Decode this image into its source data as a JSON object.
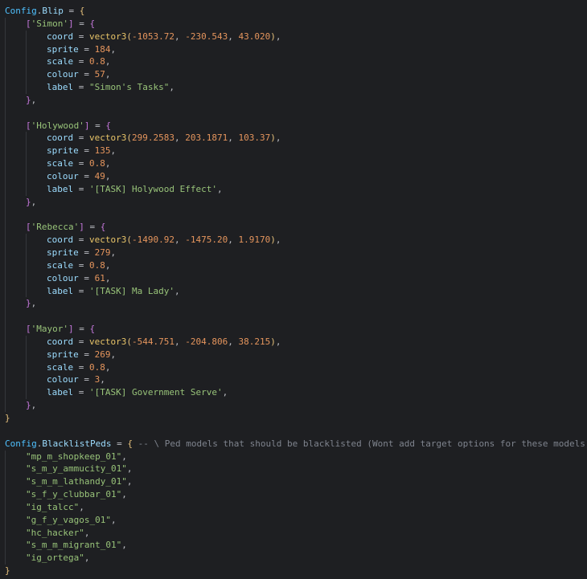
{
  "editor": {
    "language": "lua",
    "colors": {
      "background": "#1e1f22",
      "text": "#bcbec4",
      "object": "#4fc1ff",
      "property": "#9cdcfe",
      "string": "#98c379",
      "number": "#e5955d",
      "function": "#e8c468",
      "brace": "#e5c07b",
      "brace_nested": "#c678dd",
      "comment": "#7f848e"
    },
    "lines": [
      {
        "indent": 0,
        "tokens": [
          [
            "obj",
            "Config"
          ],
          [
            "op",
            "."
          ],
          [
            "prop",
            "Blip"
          ],
          [
            "op",
            " = "
          ],
          [
            "brace",
            "{"
          ]
        ]
      },
      {
        "indent": 1,
        "tokens": [
          [
            "brace2",
            "["
          ],
          [
            "str",
            "'Simon'"
          ],
          [
            "brace2",
            "]"
          ],
          [
            "op",
            " = "
          ],
          [
            "brace2",
            "{"
          ]
        ]
      },
      {
        "indent": 2,
        "tokens": [
          [
            "prop",
            "coord"
          ],
          [
            "op",
            " = "
          ],
          [
            "fn",
            "vector3"
          ],
          [
            "brace",
            "("
          ],
          [
            "num",
            "-1053.72"
          ],
          [
            "punc",
            ", "
          ],
          [
            "num",
            "-230.543"
          ],
          [
            "punc",
            ", "
          ],
          [
            "num",
            "43.020"
          ],
          [
            "brace",
            ")"
          ],
          [
            "punc",
            ","
          ]
        ]
      },
      {
        "indent": 2,
        "tokens": [
          [
            "prop",
            "sprite"
          ],
          [
            "op",
            " = "
          ],
          [
            "num",
            "184"
          ],
          [
            "punc",
            ","
          ]
        ]
      },
      {
        "indent": 2,
        "tokens": [
          [
            "prop",
            "scale"
          ],
          [
            "op",
            " = "
          ],
          [
            "num",
            "0.8"
          ],
          [
            "punc",
            ","
          ]
        ]
      },
      {
        "indent": 2,
        "tokens": [
          [
            "prop",
            "colour"
          ],
          [
            "op",
            " = "
          ],
          [
            "num",
            "57"
          ],
          [
            "punc",
            ","
          ]
        ]
      },
      {
        "indent": 2,
        "tokens": [
          [
            "prop",
            "label"
          ],
          [
            "op",
            " = "
          ],
          [
            "str",
            "\"Simon's Tasks\""
          ],
          [
            "punc",
            ","
          ]
        ]
      },
      {
        "indent": 1,
        "tokens": [
          [
            "brace2",
            "}"
          ],
          [
            "punc",
            ","
          ]
        ]
      },
      {
        "indent": 1,
        "tokens": []
      },
      {
        "indent": 1,
        "tokens": [
          [
            "brace2",
            "["
          ],
          [
            "str",
            "'Holywood'"
          ],
          [
            "brace2",
            "]"
          ],
          [
            "op",
            " = "
          ],
          [
            "brace2",
            "{"
          ]
        ]
      },
      {
        "indent": 2,
        "tokens": [
          [
            "prop",
            "coord"
          ],
          [
            "op",
            " = "
          ],
          [
            "fn",
            "vector3"
          ],
          [
            "brace",
            "("
          ],
          [
            "num",
            "299.2583"
          ],
          [
            "punc",
            ", "
          ],
          [
            "num",
            "203.1871"
          ],
          [
            "punc",
            ", "
          ],
          [
            "num",
            "103.37"
          ],
          [
            "brace",
            ")"
          ],
          [
            "punc",
            ","
          ]
        ]
      },
      {
        "indent": 2,
        "tokens": [
          [
            "prop",
            "sprite"
          ],
          [
            "op",
            " = "
          ],
          [
            "num",
            "135"
          ],
          [
            "punc",
            ","
          ]
        ]
      },
      {
        "indent": 2,
        "tokens": [
          [
            "prop",
            "scale"
          ],
          [
            "op",
            " = "
          ],
          [
            "num",
            "0.8"
          ],
          [
            "punc",
            ","
          ]
        ]
      },
      {
        "indent": 2,
        "tokens": [
          [
            "prop",
            "colour"
          ],
          [
            "op",
            " = "
          ],
          [
            "num",
            "49"
          ],
          [
            "punc",
            ","
          ]
        ]
      },
      {
        "indent": 2,
        "tokens": [
          [
            "prop",
            "label"
          ],
          [
            "op",
            " = "
          ],
          [
            "str",
            "'[TASK] Holywood Effect'"
          ],
          [
            "punc",
            ","
          ]
        ]
      },
      {
        "indent": 1,
        "tokens": [
          [
            "brace2",
            "}"
          ],
          [
            "punc",
            ","
          ]
        ]
      },
      {
        "indent": 1,
        "tokens": []
      },
      {
        "indent": 1,
        "tokens": [
          [
            "brace2",
            "["
          ],
          [
            "str",
            "'Rebecca'"
          ],
          [
            "brace2",
            "]"
          ],
          [
            "op",
            " = "
          ],
          [
            "brace2",
            "{"
          ]
        ]
      },
      {
        "indent": 2,
        "tokens": [
          [
            "prop",
            "coord"
          ],
          [
            "op",
            " = "
          ],
          [
            "fn",
            "vector3"
          ],
          [
            "brace",
            "("
          ],
          [
            "num",
            "-1490.92"
          ],
          [
            "punc",
            ", "
          ],
          [
            "num",
            "-1475.20"
          ],
          [
            "punc",
            ", "
          ],
          [
            "num",
            "1.9170"
          ],
          [
            "brace",
            ")"
          ],
          [
            "punc",
            ","
          ]
        ]
      },
      {
        "indent": 2,
        "tokens": [
          [
            "prop",
            "sprite"
          ],
          [
            "op",
            " = "
          ],
          [
            "num",
            "279"
          ],
          [
            "punc",
            ","
          ]
        ]
      },
      {
        "indent": 2,
        "tokens": [
          [
            "prop",
            "scale"
          ],
          [
            "op",
            " = "
          ],
          [
            "num",
            "0.8"
          ],
          [
            "punc",
            ","
          ]
        ]
      },
      {
        "indent": 2,
        "tokens": [
          [
            "prop",
            "colour"
          ],
          [
            "op",
            " = "
          ],
          [
            "num",
            "61"
          ],
          [
            "punc",
            ","
          ]
        ]
      },
      {
        "indent": 2,
        "tokens": [
          [
            "prop",
            "label"
          ],
          [
            "op",
            " = "
          ],
          [
            "str",
            "'[TASK] Ma Lady'"
          ],
          [
            "punc",
            ","
          ]
        ]
      },
      {
        "indent": 1,
        "tokens": [
          [
            "brace2",
            "}"
          ],
          [
            "punc",
            ","
          ]
        ]
      },
      {
        "indent": 1,
        "tokens": []
      },
      {
        "indent": 1,
        "tokens": [
          [
            "brace2",
            "["
          ],
          [
            "str",
            "'Mayor'"
          ],
          [
            "brace2",
            "]"
          ],
          [
            "op",
            " = "
          ],
          [
            "brace2",
            "{"
          ]
        ]
      },
      {
        "indent": 2,
        "tokens": [
          [
            "prop",
            "coord"
          ],
          [
            "op",
            " = "
          ],
          [
            "fn",
            "vector3"
          ],
          [
            "brace",
            "("
          ],
          [
            "num",
            "-544.751"
          ],
          [
            "punc",
            ", "
          ],
          [
            "num",
            "-204.806"
          ],
          [
            "punc",
            ", "
          ],
          [
            "num",
            "38.215"
          ],
          [
            "brace",
            ")"
          ],
          [
            "punc",
            ","
          ]
        ]
      },
      {
        "indent": 2,
        "tokens": [
          [
            "prop",
            "sprite"
          ],
          [
            "op",
            " = "
          ],
          [
            "num",
            "269"
          ],
          [
            "punc",
            ","
          ]
        ]
      },
      {
        "indent": 2,
        "tokens": [
          [
            "prop",
            "scale"
          ],
          [
            "op",
            " = "
          ],
          [
            "num",
            "0.8"
          ],
          [
            "punc",
            ","
          ]
        ]
      },
      {
        "indent": 2,
        "tokens": [
          [
            "prop",
            "colour"
          ],
          [
            "op",
            " = "
          ],
          [
            "num",
            "3"
          ],
          [
            "punc",
            ","
          ]
        ]
      },
      {
        "indent": 2,
        "tokens": [
          [
            "prop",
            "label"
          ],
          [
            "op",
            " = "
          ],
          [
            "str",
            "'[TASK] Government Serve'"
          ],
          [
            "punc",
            ","
          ]
        ]
      },
      {
        "indent": 1,
        "tokens": [
          [
            "brace2",
            "}"
          ],
          [
            "punc",
            ","
          ]
        ]
      },
      {
        "indent": 0,
        "tokens": [
          [
            "brace",
            "}"
          ]
        ]
      },
      {
        "indent": 0,
        "tokens": []
      },
      {
        "indent": 0,
        "tokens": [
          [
            "obj",
            "Config"
          ],
          [
            "op",
            "."
          ],
          [
            "prop",
            "BlacklistPeds"
          ],
          [
            "op",
            " = "
          ],
          [
            "brace",
            "{"
          ],
          [
            "op",
            " "
          ],
          [
            "com",
            "-- \\ Ped models that should be blacklisted (Wont add target options for these models)"
          ]
        ]
      },
      {
        "indent": 1,
        "tokens": [
          [
            "str",
            "\"mp_m_shopkeep_01\""
          ],
          [
            "punc",
            ","
          ]
        ]
      },
      {
        "indent": 1,
        "tokens": [
          [
            "str",
            "\"s_m_y_ammucity_01\""
          ],
          [
            "punc",
            ","
          ]
        ]
      },
      {
        "indent": 1,
        "tokens": [
          [
            "str",
            "\"s_m_m_lathandy_01\""
          ],
          [
            "punc",
            ","
          ]
        ]
      },
      {
        "indent": 1,
        "tokens": [
          [
            "str",
            "\"s_f_y_clubbar_01\""
          ],
          [
            "punc",
            ","
          ]
        ]
      },
      {
        "indent": 1,
        "tokens": [
          [
            "str",
            "\"ig_talcc\""
          ],
          [
            "punc",
            ","
          ]
        ]
      },
      {
        "indent": 1,
        "tokens": [
          [
            "str",
            "\"g_f_y_vagos_01\""
          ],
          [
            "punc",
            ","
          ]
        ]
      },
      {
        "indent": 1,
        "tokens": [
          [
            "str",
            "\"hc_hacker\""
          ],
          [
            "punc",
            ","
          ]
        ]
      },
      {
        "indent": 1,
        "tokens": [
          [
            "str",
            "\"s_m_m_migrant_01\""
          ],
          [
            "punc",
            ","
          ]
        ]
      },
      {
        "indent": 1,
        "tokens": [
          [
            "str",
            "\"ig_ortega\""
          ],
          [
            "punc",
            ","
          ]
        ]
      },
      {
        "indent": 0,
        "tokens": [
          [
            "brace",
            "}"
          ]
        ]
      }
    ]
  }
}
